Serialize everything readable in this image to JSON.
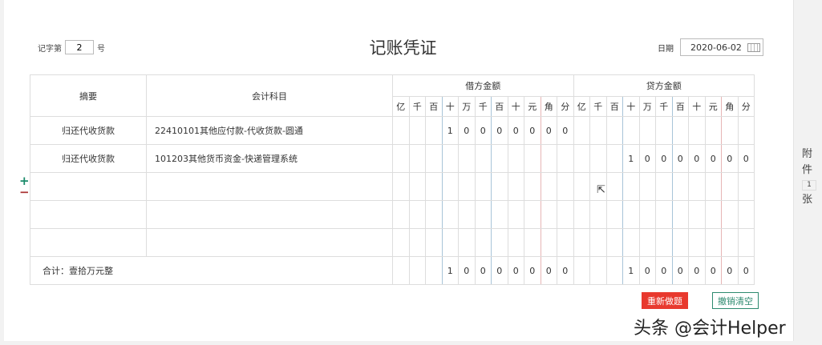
{
  "header": {
    "voucher_prefix": "记字第",
    "voucher_no": "2",
    "voucher_suffix": "号",
    "title": "记账凭证",
    "date_label": "日期",
    "date_value": "2020-06-02"
  },
  "table": {
    "col_summary": "摘要",
    "col_account": "会计科目",
    "debit_label": "借方金额",
    "credit_label": "贷方金额",
    "digits": [
      "亿",
      "千",
      "百",
      "十",
      "万",
      "千",
      "百",
      "十",
      "元",
      "角",
      "分"
    ],
    "rows": [
      {
        "summary": "归还代收货款",
        "account": "22410101其他应付款-代收货款-圆通",
        "debit": [
          "",
          "",
          "",
          "1",
          "0",
          "0",
          "0",
          "0",
          "0",
          "0",
          "0"
        ],
        "credit": [
          "",
          "",
          "",
          "",
          "",
          "",
          "",
          "",
          "",
          "",
          ""
        ]
      },
      {
        "summary": "归还代收货款",
        "account": "101203其他货币资金-快递管理系统",
        "debit": [
          "",
          "",
          "",
          "",
          "",
          "",
          "",
          "",
          "",
          "",
          ""
        ],
        "credit": [
          "",
          "",
          "",
          "1",
          "0",
          "0",
          "0",
          "0",
          "0",
          "0",
          "0"
        ]
      },
      {
        "summary": "",
        "account": "",
        "debit": [
          "",
          "",
          "",
          "",
          "",
          "",
          "",
          "",
          "",
          "",
          ""
        ],
        "credit": [
          "",
          "",
          "",
          "",
          "",
          "",
          "",
          "",
          "",
          "",
          ""
        ]
      },
      {
        "summary": "",
        "account": "",
        "debit": [
          "",
          "",
          "",
          "",
          "",
          "",
          "",
          "",
          "",
          "",
          ""
        ],
        "credit": [
          "",
          "",
          "",
          "",
          "",
          "",
          "",
          "",
          "",
          "",
          ""
        ]
      },
      {
        "summary": "",
        "account": "",
        "debit": [
          "",
          "",
          "",
          "",
          "",
          "",
          "",
          "",
          "",
          "",
          ""
        ],
        "credit": [
          "",
          "",
          "",
          "",
          "",
          "",
          "",
          "",
          "",
          "",
          ""
        ]
      }
    ],
    "total_label": "合计：壹拾万元整",
    "total_debit": [
      "",
      "",
      "",
      "1",
      "0",
      "0",
      "0",
      "0",
      "0",
      "0",
      "0"
    ],
    "total_credit": [
      "",
      "",
      "",
      "1",
      "0",
      "0",
      "0",
      "0",
      "0",
      "0",
      "0"
    ]
  },
  "buttons": {
    "redo": "重新做题",
    "clear": "撤销清空",
    "add_row": "+",
    "remove_row": "−"
  },
  "attachment": {
    "label_top1": "附",
    "label_top2": "件",
    "count": "1",
    "label_bottom": "张"
  },
  "watermark": "头条 @会计Helper"
}
